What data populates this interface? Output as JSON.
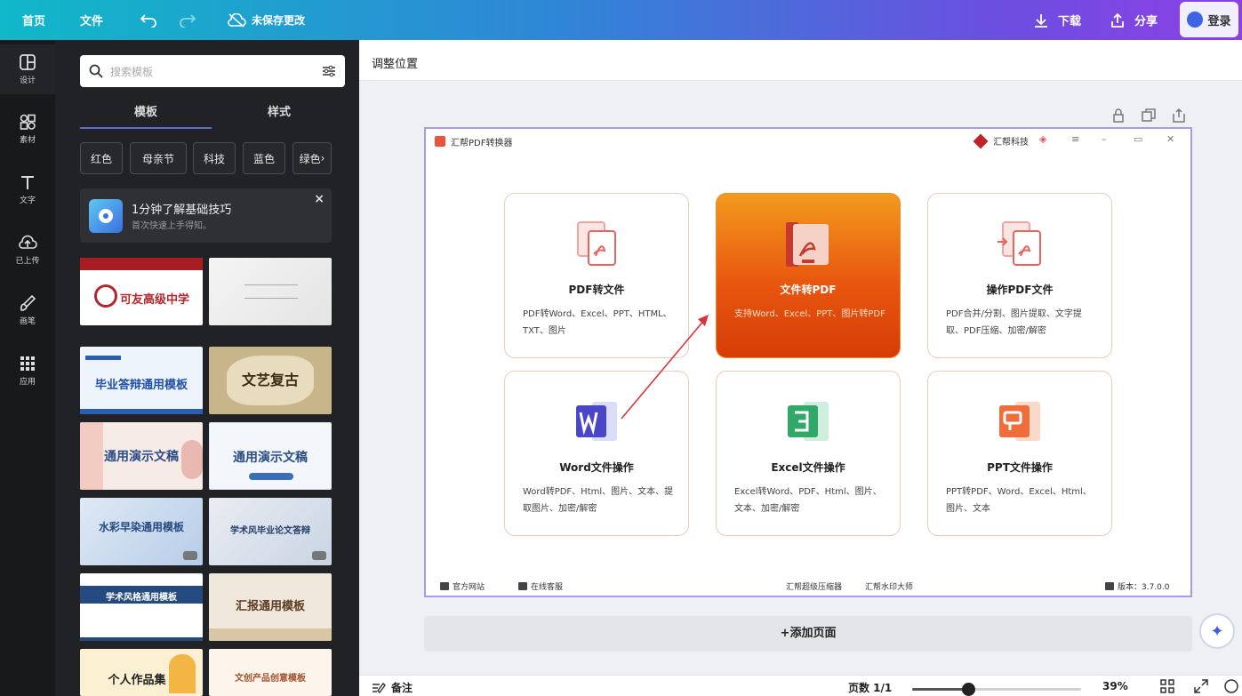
{
  "topbar": {
    "home": "首页",
    "file": "文件",
    "unsaved": "未保存更改",
    "download": "下载",
    "share": "分享",
    "login": "登录"
  },
  "rail": [
    {
      "label": "设计",
      "icon": "design-icon"
    },
    {
      "label": "素材",
      "icon": "elements-icon"
    },
    {
      "label": "文字",
      "icon": "text-icon"
    },
    {
      "label": "已上传",
      "icon": "upload-icon"
    },
    {
      "label": "画笔",
      "icon": "brush-icon"
    },
    {
      "label": "应用",
      "icon": "apps-icon"
    }
  ],
  "panel": {
    "search_placeholder": "搜索模板",
    "tabs": [
      "模板",
      "样式"
    ],
    "chips": [
      "红色",
      "母亲节",
      "科技",
      "蓝色",
      "绿色"
    ],
    "tip": {
      "title": "1分钟了解基础技巧",
      "subtitle": "首次快速上手得知。"
    },
    "thumbs": [
      {
        "text": "可友高级中学"
      },
      {
        "text": ""
      },
      {
        "text": "毕业答辩通用模板"
      },
      {
        "text": "文艺复古"
      },
      {
        "text": "通用演示文稿"
      },
      {
        "text": "通用演示文稿"
      },
      {
        "text": "水彩早染通用模板"
      },
      {
        "text": "学术风毕业论文答辩"
      },
      {
        "text": "学术风格通用模板"
      },
      {
        "text": "汇报通用模板"
      },
      {
        "text": "个人作品集"
      },
      {
        "text": "文创产品创意模板"
      }
    ]
  },
  "workspace": {
    "header_title": "调整位置",
    "add_page": "+添加页面",
    "notes": "备注",
    "pages": "页数 1/1",
    "zoom_label": "39%",
    "zoom_fraction": 0.39
  },
  "app": {
    "title": "汇帮PDF转换器",
    "brand": "汇帮科技",
    "cards": [
      {
        "title": "PDF转文件",
        "desc": "PDF转Word、Excel、PPT、HTML、TXT、图片",
        "icon": "pdf-convert-icon",
        "highlight": false
      },
      {
        "title": "文件转PDF",
        "desc": "支持Word、Excel、PPT、图片转PDF",
        "icon": "file-to-pdf-icon",
        "highlight": true
      },
      {
        "title": "操作PDF文件",
        "desc": "PDF合并/分割、图片提取、文字提取、PDF压缩、加密/解密",
        "icon": "pdf-operate-icon",
        "highlight": false
      },
      {
        "title": "Word文件操作",
        "desc": "Word转PDF、Html、图片、文本、提取图片、加密/解密",
        "icon": "word-icon",
        "highlight": false
      },
      {
        "title": "Excel文件操作",
        "desc": "Excel转Word、PDF、Html、图片、文本、加密/解密",
        "icon": "excel-icon",
        "highlight": false
      },
      {
        "title": "PPT文件操作",
        "desc": "PPT转PDF、Word、Excel、Html、图片、文本",
        "icon": "ppt-icon",
        "highlight": false
      }
    ],
    "footer": {
      "website": "官方网站",
      "service": "在线客服",
      "link1": "汇帮超级压缩器",
      "link2": "汇帮水印大师",
      "version": "版本：3.7.0.0"
    }
  },
  "colors": {
    "accent": "#5b6bd8",
    "card_highlight": "#e8560f",
    "arrow": "#d9343c"
  }
}
